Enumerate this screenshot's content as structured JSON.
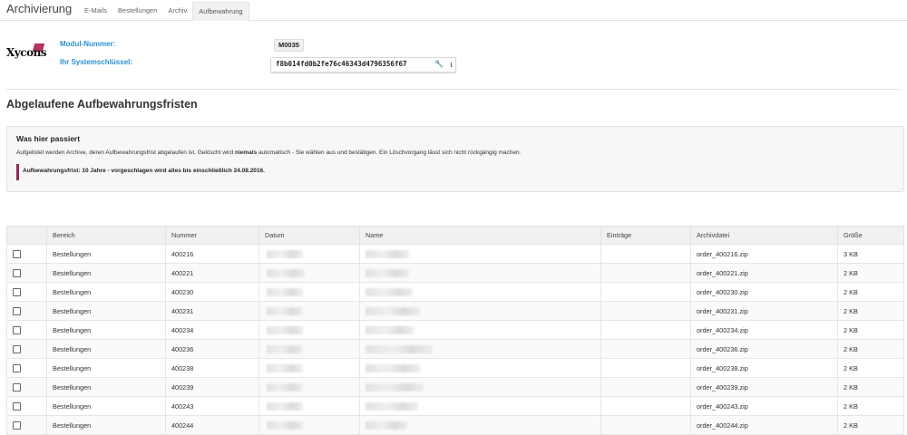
{
  "header": {
    "title": "Archivierung",
    "tabs": [
      {
        "label": "E-Mails"
      },
      {
        "label": "Bestellungen"
      },
      {
        "label": "Archiv"
      },
      {
        "label": "Aufbewahrung"
      }
    ],
    "active_tab": "Aufbewahrung"
  },
  "info": {
    "logo_text": "Xycons",
    "module_label": "Modul-Nummer:",
    "module_value": "M0035",
    "key_label": "Ihr Systemschlüssel:",
    "key_value": "f8b014fd0b2fe76c46343d4796356f67"
  },
  "section": {
    "title": "Abgelaufene Aufbewahrungsfristen"
  },
  "notice": {
    "title": "Was hier passiert",
    "text_before": "Aufgelistet werden Archive, deren Aufbewahrungsfrist abgelaufen ist. Gelöscht wird ",
    "text_bold": "niemals",
    "text_after": " automatisch - Sie wählen aus und bestätigen. Ein Löschvorgang lässt sich nicht rückgängig machen.",
    "hint": "Aufbewahrungsfrist: 10 Jahre - vorgeschlagen wird alles bis einschließlich 24.08.2016."
  },
  "table": {
    "columns": [
      "",
      "Bereich",
      "Nummer",
      "Datum",
      "Name",
      "Einträge",
      "Archivdatei",
      "Größe"
    ],
    "rows": [
      {
        "bereich": "Bestellungen",
        "nummer": "400216",
        "datei": "order_400216.zip",
        "groesse": "3 KB"
      },
      {
        "bereich": "Bestellungen",
        "nummer": "400221",
        "datei": "order_400221.zip",
        "groesse": "2 KB"
      },
      {
        "bereich": "Bestellungen",
        "nummer": "400230",
        "datei": "order_400230.zip",
        "groesse": "2 KB"
      },
      {
        "bereich": "Bestellungen",
        "nummer": "400231",
        "datei": "order_400231.zip",
        "groesse": "2 KB"
      },
      {
        "bereich": "Bestellungen",
        "nummer": "400234",
        "datei": "order_400234.zip",
        "groesse": "2 KB"
      },
      {
        "bereich": "Bestellungen",
        "nummer": "400236",
        "datei": "order_400236.zip",
        "groesse": "2 KB"
      },
      {
        "bereich": "Bestellungen",
        "nummer": "400238",
        "datei": "order_400238.zip",
        "groesse": "2 KB"
      },
      {
        "bereich": "Bestellungen",
        "nummer": "400239",
        "datei": "order_400239.zip",
        "groesse": "2 KB"
      },
      {
        "bereich": "Bestellungen",
        "nummer": "400243",
        "datei": "order_400243.zip",
        "groesse": "2 KB"
      },
      {
        "bereich": "Bestellungen",
        "nummer": "400244",
        "datei": "order_400244.zip",
        "groesse": "2 KB"
      }
    ]
  },
  "icons": {
    "wrench": "wrench-icon",
    "download": "download-icon",
    "checkbox": "checkbox"
  },
  "colors": {
    "label_blue": "#2b8fd0",
    "accent": "#8e2a5a"
  }
}
